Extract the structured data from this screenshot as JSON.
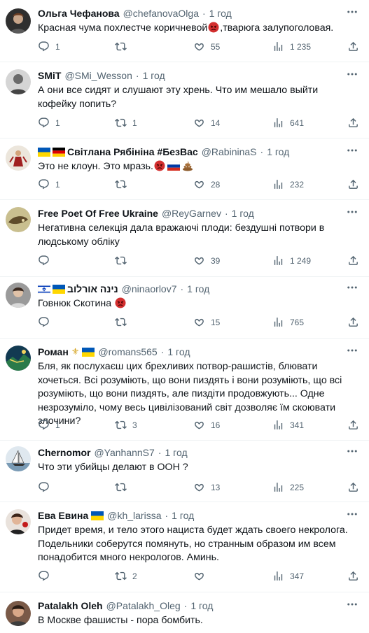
{
  "tweets": [
    {
      "name": "Ольга Чефанова",
      "handle": "@chefanovaOlga",
      "sep": "·",
      "time": "1 год",
      "text": "Красная чума похлестче коричневой",
      "text_after": ",тварюга залупоголовая.",
      "replies": "1",
      "retweets": "",
      "likes": "55",
      "views": "1 235",
      "avatar_color": "#3a3a3a"
    },
    {
      "name": "SMiT",
      "handle": "@SMi_Wesson",
      "sep": "·",
      "time": "1 год",
      "text": "А они все сидят и слушают эту хрень. Что им мешало выйти кофейку попить?",
      "replies": "1",
      "retweets": "1",
      "likes": "14",
      "views": "641",
      "avatar_color": "#c9c9c9"
    },
    {
      "name": "Світлана Рябініна #БезВас",
      "handle": "@RabininaS",
      "sep": "·",
      "time": "1 год",
      "text": "Это не клоун. Это мразь.",
      "replies": "1",
      "retweets": "",
      "likes": "28",
      "views": "232",
      "avatar_color": "#e8e2d8"
    },
    {
      "name": "Free Poet Of Free Ukraine",
      "handle": "@ReyGarnev",
      "sep": "·",
      "time": "1 год",
      "text": "Негативна селекція дала вражаючі плоди: бездушні потвори в людському обліку",
      "replies": "",
      "retweets": "",
      "likes": "39",
      "views": "1 249",
      "avatar_color": "#a79b6a"
    },
    {
      "name": "נינה אורלוב",
      "handle": "@ninaorlov7",
      "sep": "·",
      "time": "1 год",
      "text": "Говнюк Скотина",
      "replies": "",
      "retweets": "",
      "likes": "15",
      "views": "765",
      "avatar_color": "#8f8f8f"
    },
    {
      "name": "Роман",
      "handle": "@romans565",
      "sep": "·",
      "time": "1 год",
      "text": "Бля, як послухаєш цих брехливих потвор-рашистів, блювати хочеться. Всі розуміють, що вони пиздять і вони розуміють, що всі розуміють, що вони пиздять, але пиздіти продовжують... Одне незрозуміло, чому весь цивілізований світ дозволяє їм скоювати злочини?",
      "replies": "1",
      "retweets": "3",
      "likes": "16",
      "views": "341",
      "avatar_color": "#1d4f6e"
    },
    {
      "name": "Chernomor",
      "handle": "@YanhannS7",
      "sep": "·",
      "time": "1 год",
      "text": "Что эти убийцы делают в ООН ?",
      "replies": "",
      "retweets": "",
      "likes": "13",
      "views": "225",
      "avatar_color": "#d9e3ea"
    },
    {
      "name": "Ева Евина",
      "handle": "@kh_larissa",
      "sep": "·",
      "time": "1 год",
      "text": "Придет время, и тело этого нациста будет ждать своего некролога. Подельники соберутся помянуть, но странным образом им всем понадобится много некрологов. Аминь.",
      "replies": "",
      "retweets": "2",
      "likes": "",
      "views": "347",
      "avatar_color": "#5b3c2e"
    },
    {
      "name": "Patalakh Oleh",
      "handle": "@Patalakh_Oleg",
      "sep": "·",
      "time": "1 год",
      "text": "В Москве фашисты - пора бомбить.",
      "replies": "",
      "retweets": "",
      "likes": "",
      "views": "",
      "avatar_color": "#6b4a3a"
    }
  ],
  "icons": {
    "reply": "reply-icon",
    "retweet": "retweet-icon",
    "like": "like-icon",
    "views": "views-icon",
    "share": "share-icon",
    "more": "more-icon"
  },
  "colors": {
    "muted": "#536471",
    "text": "#0f1419",
    "divider": "#eff3f4"
  }
}
